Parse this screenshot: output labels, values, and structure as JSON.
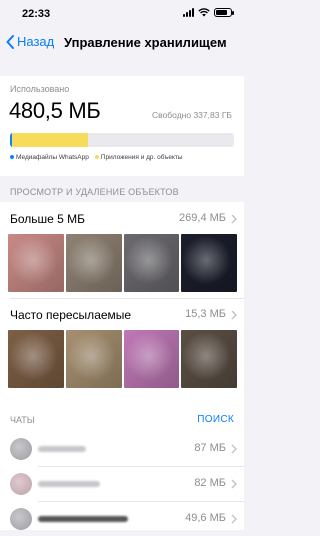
{
  "status_bar": {
    "time": "22:33"
  },
  "nav": {
    "back_label": "Назад",
    "title": "Управление хранилищем"
  },
  "usage": {
    "used_label": "Использовано",
    "used_value": "480,5 МБ",
    "free_label": "Свободно 337,83 ГБ",
    "whatsapp_fraction": 0.01,
    "apps_fraction": 0.34,
    "legend": [
      {
        "label": "Медиафайлы WhatsApp",
        "color": "#0b84ff"
      },
      {
        "label": "Приложения и др. объекты",
        "color": "#f6dc5a"
      }
    ]
  },
  "media_section": {
    "header": "ПРОСМОТР И УДАЛЕНИЕ ОБЪЕКТОВ",
    "groups": [
      {
        "name": "Больше 5 МБ",
        "size": "269,4 МБ",
        "thumbs": [
          "#c98a86",
          "#8f8273",
          "#6c6a6f",
          "#1b1f2c"
        ]
      },
      {
        "name": "Часто пересылаемые",
        "size": "15,3 МБ",
        "thumbs": [
          "#7e5f45",
          "#a79070",
          "#c078b7",
          "#5b4f44"
        ]
      }
    ]
  },
  "chats_section": {
    "header": "ЧАТЫ",
    "search_label": "ПОИСК",
    "chats": [
      {
        "size": "87 МБ"
      },
      {
        "size": "82 МБ"
      },
      {
        "size": "49,6 МБ"
      }
    ]
  }
}
